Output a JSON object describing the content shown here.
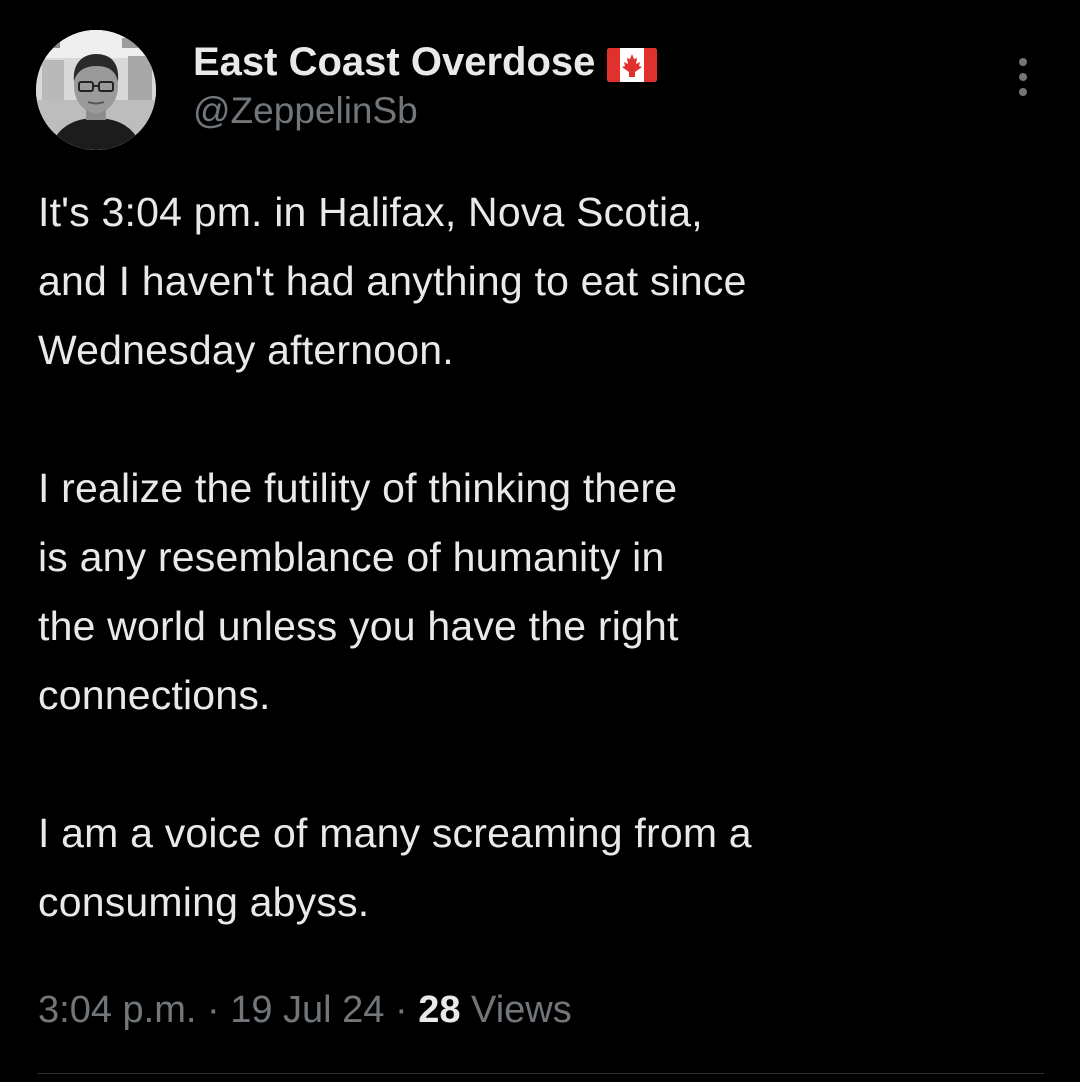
{
  "author": {
    "display_name": "East Coast Overdose",
    "handle": "@ZeppelinSb",
    "flag_icon": "canada-flag-icon",
    "avatar_icon": "user-avatar"
  },
  "tweet": {
    "text": "It's 3:04 pm. in Halifax, Nova Scotia,\nand I haven't had anything to eat since\nWednesday afternoon.\n\nI realize the futility of thinking there\nis any resemblance of humanity in\nthe world unless you have the right\nconnections.\n\nI am a voice of many screaming from a\nconsuming abyss."
  },
  "meta": {
    "time": "3:04 p.m.",
    "separator": " · ",
    "date": "19 Jul 24",
    "views_count": "28",
    "views_label": " Views"
  },
  "colors": {
    "background": "#000000",
    "primary_text": "#e7e9ea",
    "secondary_text": "#71767b",
    "divider": "#2f3336",
    "flag_red": "#e0312e"
  },
  "menu": {
    "more_icon": "more-vertical-icon"
  }
}
